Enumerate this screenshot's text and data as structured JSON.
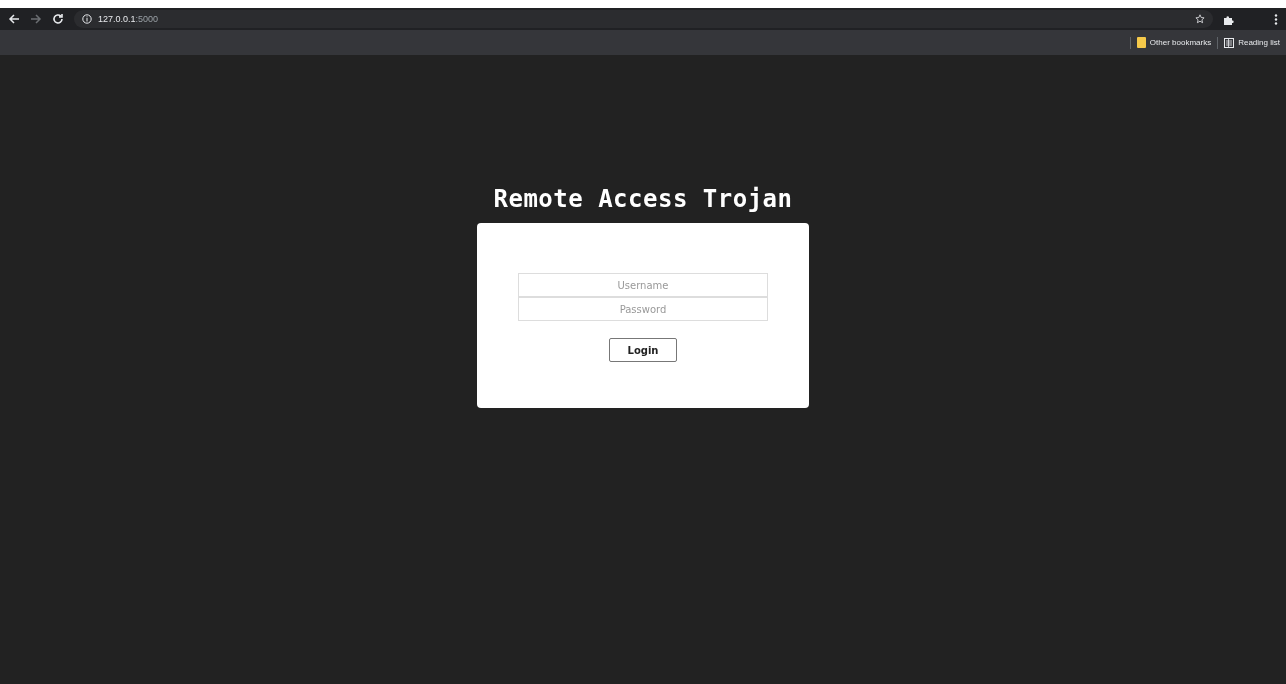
{
  "browser": {
    "url": {
      "host": "127.0.0.1",
      "port": ":5000"
    },
    "bookmarks": [
      {
        "kind": "folder",
        "label": "Other bookmarks"
      },
      {
        "kind": "reading",
        "label": "Reading list"
      }
    ]
  },
  "page": {
    "title": "Remote Access Trojan",
    "fields": [
      {
        "placeholder": "Username"
      },
      {
        "placeholder": "Password"
      }
    ],
    "button": "Login"
  }
}
